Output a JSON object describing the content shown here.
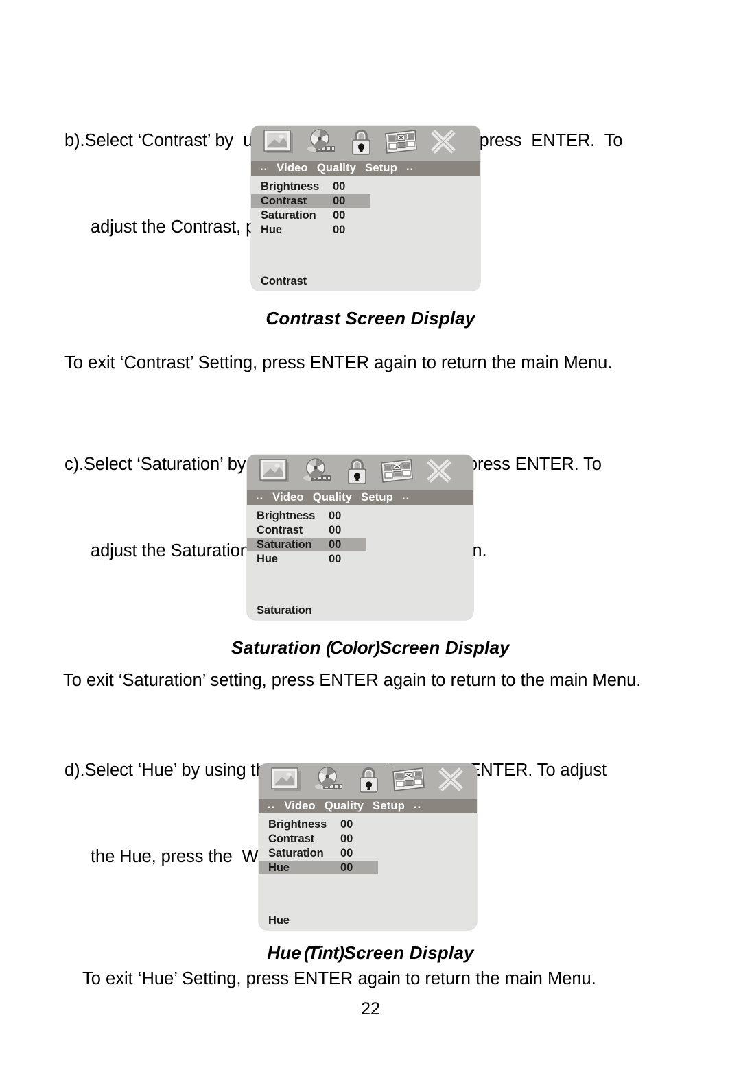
{
  "document": {
    "page_number": "22"
  },
  "sections": [
    {
      "id": "contrast",
      "instruction": {
        "line1": "b).Select ‘Contrast’ by  using  the   S/ T  button,  then  press  ENTER.  To",
        "line2": "adjust the Contrast, press the  W WX X button."
      },
      "caption": "Contrast Screen Display",
      "exit_note": "To exit ‘Contrast’ Setting, press ENTER again to return the main Menu."
    },
    {
      "id": "saturation",
      "instruction": {
        "line1": "c).Select ‘Saturation’ by using the  S/ T  button, then press ENTER. To",
        "line2": "adjust the Saturation, by press the  W WX X button."
      },
      "caption_pre": "Saturation ",
      "caption_paren_open": "(",
      "caption_mid": "Color)",
      "caption_post": "Screen Display",
      "exit_note": "To exit ‘Saturation’ setting, press ENTER again to return to the main Menu."
    },
    {
      "id": "hue",
      "instruction": {
        "line1": "d).Select ‘Hue’ by using the  S/ T  button, then press ENTER. To adjust",
        "line2": "the Hue, press the  W WX X button."
      },
      "caption_pre": "Hue",
      "caption_paren_open": " (",
      "caption_mid": "Tint)",
      "caption_post": "Screen Display",
      "exit_note": "To exit ‘Hue’ Setting, press ENTER again to return the main Menu."
    }
  ],
  "osd": {
    "icons": [
      "picture-icon",
      "film-reel-icon",
      "lock-icon",
      "multiscreen-grid-icon",
      "close-x-icon"
    ],
    "menubar": {
      "left_dots": "..",
      "items": [
        "Video",
        "Quality",
        "Setup"
      ],
      "right_dots": ".."
    },
    "rows": [
      {
        "label": "Brightness",
        "value": "00"
      },
      {
        "label": "Contrast",
        "value": "00"
      },
      {
        "label": "Saturation",
        "value": "00"
      },
      {
        "label": "Hue",
        "value": "00"
      }
    ],
    "screens": [
      {
        "id": "contrast-osd",
        "selected_index": 1,
        "footer": "Contrast"
      },
      {
        "id": "saturation-osd",
        "selected_index": 2,
        "footer": "Saturation"
      },
      {
        "id": "hue-osd",
        "selected_index": 3,
        "footer": "Hue"
      }
    ]
  },
  "colors": {
    "panel_body": "#e3e3e1",
    "icon_bar": "#b2b1ae",
    "menu_bar": "#8a857f",
    "highlight": "#a9a8a5",
    "text": "#1b1b1b"
  }
}
